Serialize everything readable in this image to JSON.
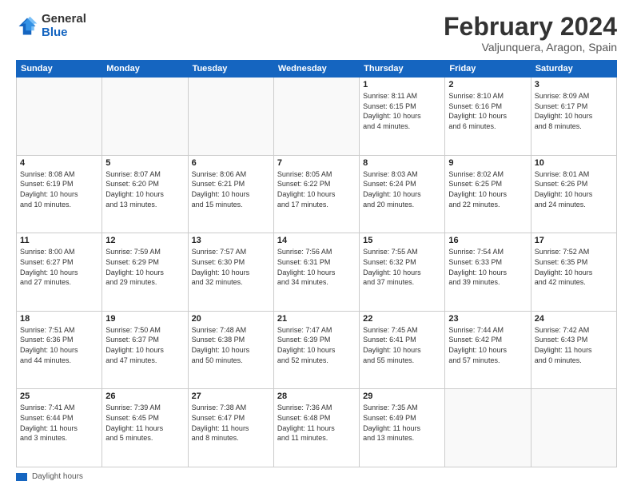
{
  "logo": {
    "general": "General",
    "blue": "Blue"
  },
  "title": "February 2024",
  "location": "Valjunquera, Aragon, Spain",
  "days_of_week": [
    "Sunday",
    "Monday",
    "Tuesday",
    "Wednesday",
    "Thursday",
    "Friday",
    "Saturday"
  ],
  "legend_label": "Daylight hours",
  "weeks": [
    [
      {
        "day": "",
        "info": ""
      },
      {
        "day": "",
        "info": ""
      },
      {
        "day": "",
        "info": ""
      },
      {
        "day": "",
        "info": ""
      },
      {
        "day": "1",
        "info": "Sunrise: 8:11 AM\nSunset: 6:15 PM\nDaylight: 10 hours\nand 4 minutes."
      },
      {
        "day": "2",
        "info": "Sunrise: 8:10 AM\nSunset: 6:16 PM\nDaylight: 10 hours\nand 6 minutes."
      },
      {
        "day": "3",
        "info": "Sunrise: 8:09 AM\nSunset: 6:17 PM\nDaylight: 10 hours\nand 8 minutes."
      }
    ],
    [
      {
        "day": "4",
        "info": "Sunrise: 8:08 AM\nSunset: 6:19 PM\nDaylight: 10 hours\nand 10 minutes."
      },
      {
        "day": "5",
        "info": "Sunrise: 8:07 AM\nSunset: 6:20 PM\nDaylight: 10 hours\nand 13 minutes."
      },
      {
        "day": "6",
        "info": "Sunrise: 8:06 AM\nSunset: 6:21 PM\nDaylight: 10 hours\nand 15 minutes."
      },
      {
        "day": "7",
        "info": "Sunrise: 8:05 AM\nSunset: 6:22 PM\nDaylight: 10 hours\nand 17 minutes."
      },
      {
        "day": "8",
        "info": "Sunrise: 8:03 AM\nSunset: 6:24 PM\nDaylight: 10 hours\nand 20 minutes."
      },
      {
        "day": "9",
        "info": "Sunrise: 8:02 AM\nSunset: 6:25 PM\nDaylight: 10 hours\nand 22 minutes."
      },
      {
        "day": "10",
        "info": "Sunrise: 8:01 AM\nSunset: 6:26 PM\nDaylight: 10 hours\nand 24 minutes."
      }
    ],
    [
      {
        "day": "11",
        "info": "Sunrise: 8:00 AM\nSunset: 6:27 PM\nDaylight: 10 hours\nand 27 minutes."
      },
      {
        "day": "12",
        "info": "Sunrise: 7:59 AM\nSunset: 6:29 PM\nDaylight: 10 hours\nand 29 minutes."
      },
      {
        "day": "13",
        "info": "Sunrise: 7:57 AM\nSunset: 6:30 PM\nDaylight: 10 hours\nand 32 minutes."
      },
      {
        "day": "14",
        "info": "Sunrise: 7:56 AM\nSunset: 6:31 PM\nDaylight: 10 hours\nand 34 minutes."
      },
      {
        "day": "15",
        "info": "Sunrise: 7:55 AM\nSunset: 6:32 PM\nDaylight: 10 hours\nand 37 minutes."
      },
      {
        "day": "16",
        "info": "Sunrise: 7:54 AM\nSunset: 6:33 PM\nDaylight: 10 hours\nand 39 minutes."
      },
      {
        "day": "17",
        "info": "Sunrise: 7:52 AM\nSunset: 6:35 PM\nDaylight: 10 hours\nand 42 minutes."
      }
    ],
    [
      {
        "day": "18",
        "info": "Sunrise: 7:51 AM\nSunset: 6:36 PM\nDaylight: 10 hours\nand 44 minutes."
      },
      {
        "day": "19",
        "info": "Sunrise: 7:50 AM\nSunset: 6:37 PM\nDaylight: 10 hours\nand 47 minutes."
      },
      {
        "day": "20",
        "info": "Sunrise: 7:48 AM\nSunset: 6:38 PM\nDaylight: 10 hours\nand 50 minutes."
      },
      {
        "day": "21",
        "info": "Sunrise: 7:47 AM\nSunset: 6:39 PM\nDaylight: 10 hours\nand 52 minutes."
      },
      {
        "day": "22",
        "info": "Sunrise: 7:45 AM\nSunset: 6:41 PM\nDaylight: 10 hours\nand 55 minutes."
      },
      {
        "day": "23",
        "info": "Sunrise: 7:44 AM\nSunset: 6:42 PM\nDaylight: 10 hours\nand 57 minutes."
      },
      {
        "day": "24",
        "info": "Sunrise: 7:42 AM\nSunset: 6:43 PM\nDaylight: 11 hours\nand 0 minutes."
      }
    ],
    [
      {
        "day": "25",
        "info": "Sunrise: 7:41 AM\nSunset: 6:44 PM\nDaylight: 11 hours\nand 3 minutes."
      },
      {
        "day": "26",
        "info": "Sunrise: 7:39 AM\nSunset: 6:45 PM\nDaylight: 11 hours\nand 5 minutes."
      },
      {
        "day": "27",
        "info": "Sunrise: 7:38 AM\nSunset: 6:47 PM\nDaylight: 11 hours\nand 8 minutes."
      },
      {
        "day": "28",
        "info": "Sunrise: 7:36 AM\nSunset: 6:48 PM\nDaylight: 11 hours\nand 11 minutes."
      },
      {
        "day": "29",
        "info": "Sunrise: 7:35 AM\nSunset: 6:49 PM\nDaylight: 11 hours\nand 13 minutes."
      },
      {
        "day": "",
        "info": ""
      },
      {
        "day": "",
        "info": ""
      }
    ]
  ]
}
